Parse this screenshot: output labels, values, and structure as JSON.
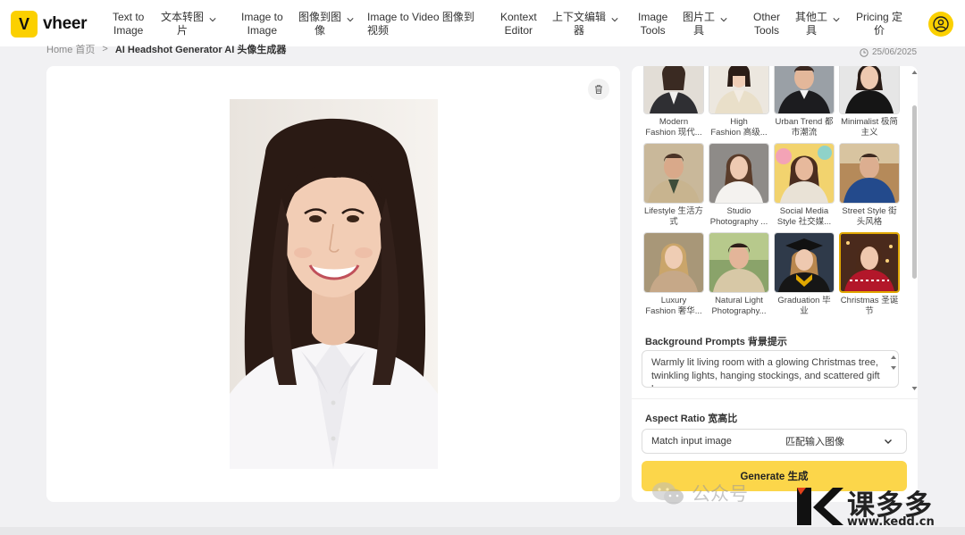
{
  "brand": {
    "name": "vheer",
    "logo_glyph": "V"
  },
  "nav": [
    {
      "line1": "Text to",
      "line2": "Image"
    },
    {
      "line1": "文本转图",
      "line2": "片"
    },
    {
      "line1": "Image to",
      "line2": "Image"
    },
    {
      "line1": "图像到图",
      "line2": "像"
    },
    {
      "line1": "Image to Video 图像到",
      "line2": "视频"
    },
    {
      "line1": "Kontext",
      "line2": "Editor"
    },
    {
      "line1": "上下文编辑",
      "line2": "器"
    },
    {
      "line1": "Image",
      "line2": "Tools"
    },
    {
      "line1": "图片工",
      "line2": "具"
    },
    {
      "line1": "Other",
      "line2": "Tools"
    },
    {
      "line1": "其他工",
      "line2": "具"
    },
    {
      "line1": "Pricing 定",
      "line2": "价"
    }
  ],
  "breadcrumb": {
    "home": "Home 首页",
    "separator": ">",
    "current": "AI Headshot Generator AI 头像生成器"
  },
  "date": "25/06/2025",
  "styles": [
    {
      "l1": "Modern",
      "l2": "Fashion 现代..."
    },
    {
      "l1": "High",
      "l2": "Fashion 高级..."
    },
    {
      "l1": "Urban Trend 都",
      "l2": "市潮流"
    },
    {
      "l1": "Minimalist 极简",
      "l2": "主义"
    },
    {
      "l1": "Lifestyle 生活方",
      "l2": "式"
    },
    {
      "l1": "Studio",
      "l2": "Photography ..."
    },
    {
      "l1": "Social Media",
      "l2": "Style 社交媒..."
    },
    {
      "l1": "Street Style 街",
      "l2": "头风格"
    },
    {
      "l1": "Luxury",
      "l2": "Fashion 奢华..."
    },
    {
      "l1": "Natural Light",
      "l2": "Photography..."
    },
    {
      "l1": "Graduation 毕",
      "l2": "业"
    },
    {
      "l1": "Christmas 圣诞",
      "l2": "节"
    }
  ],
  "background_prompts": {
    "label": "Background Prompts 背景提示",
    "value": "Warmly lit living room with a glowing Christmas tree, twinkling lights, hanging stockings, and scattered gift boxes"
  },
  "aspect_ratio": {
    "label": "Aspect Ratio 宽高比",
    "selected_en": "Match input image",
    "selected_zh": "匹配输入图像"
  },
  "generate_label": "Generate 生成",
  "watermark": {
    "wechat": "公众号",
    "kedd_cn": "课多多",
    "kedd_url": "www.kedd.cn"
  },
  "colors": {
    "brand_yellow": "#fbd000",
    "generate_bg": "#fcd64a",
    "selected_border": "#e0a700"
  }
}
